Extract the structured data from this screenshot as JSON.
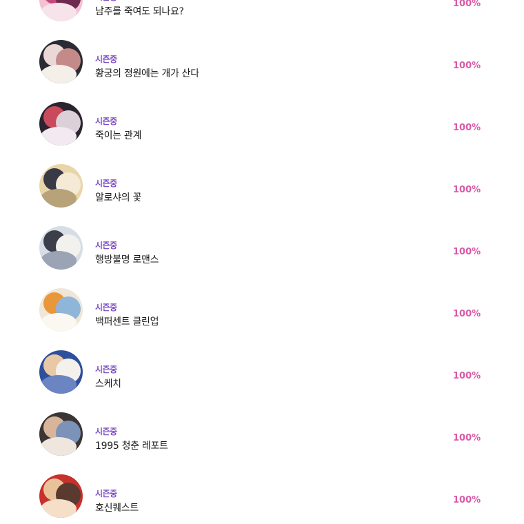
{
  "list": {
    "items": [
      {
        "status": "시즌중",
        "title": "남주를 죽여도 되나요?",
        "progress": "100%",
        "thumb_colors": [
          "#f3c1d3",
          "#c6477a",
          "#6d2a4e",
          "#f7e3ea"
        ]
      },
      {
        "status": "시즌중",
        "title": "황궁의 정원에는 개가 산다",
        "progress": "100%",
        "thumb_colors": [
          "#2b2b33",
          "#e9d8d6",
          "#c48a8a",
          "#f4efe9"
        ]
      },
      {
        "status": "시즌중",
        "title": "죽이는 관계",
        "progress": "100%",
        "thumb_colors": [
          "#2a2430",
          "#c94a5c",
          "#dcd0d8",
          "#f2eaf0"
        ]
      },
      {
        "status": "시즌중",
        "title": "알로샤의 꽃",
        "progress": "100%",
        "thumb_colors": [
          "#e9d6a8",
          "#3a3a46",
          "#f4ead6",
          "#b7a27a"
        ]
      },
      {
        "status": "시즌중",
        "title": "행방불명 로맨스",
        "progress": "100%",
        "thumb_colors": [
          "#d7dde6",
          "#3c3f4a",
          "#f3f1ee",
          "#9aa4b4"
        ]
      },
      {
        "status": "시즌중",
        "title": "백퍼센트 클린업",
        "progress": "100%",
        "thumb_colors": [
          "#f0e6d8",
          "#e8973a",
          "#8fb6d8",
          "#fbf7f1"
        ]
      },
      {
        "status": "시즌중",
        "title": "스케치",
        "progress": "100%",
        "thumb_colors": [
          "#2d4f9c",
          "#e9c8a6",
          "#f4f1ec",
          "#6b84c2"
        ]
      },
      {
        "status": "시즌중",
        "title": "1995 청춘 레포트",
        "progress": "100%",
        "thumb_colors": [
          "#3b3534",
          "#d8b49a",
          "#7c92b8",
          "#efe7de"
        ]
      },
      {
        "status": "시즌중",
        "title": "호신퀘스트",
        "progress": "100%",
        "thumb_colors": [
          "#c8302c",
          "#e8c39a",
          "#5a3a2e",
          "#f5dfc8"
        ]
      }
    ]
  }
}
